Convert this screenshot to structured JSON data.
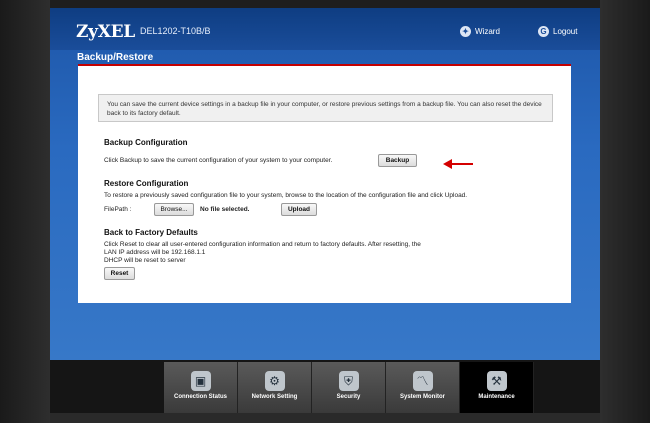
{
  "header": {
    "brand": "ZyXEL",
    "model": "DEL1202-T10B/B",
    "wizard_label": "Wizard",
    "logout_label": "Logout"
  },
  "page_title": "Backup/Restore",
  "info_text": "You can save the current device settings in a backup file in your computer, or restore previous settings from a backup file. You can also reset the device back to its factory default.",
  "backup": {
    "title": "Backup Configuration",
    "desc": "Click Backup to save the current configuration of your system to your computer.",
    "button": "Backup"
  },
  "restore": {
    "title": "Restore Configuration",
    "desc": "To restore a previously saved configuration file to your system, browse to the location of the configuration file and click Upload.",
    "filepath_label": "FilePath :",
    "browse_button": "Browse...",
    "file_status": "No file selected.",
    "upload_button": "Upload"
  },
  "factory": {
    "title": "Back to Factory Defaults",
    "line1": "Click Reset to clear all user-entered configuration information and return to factory defaults. After resetting, the",
    "line2": "LAN IP address will be 192.168.1.1",
    "line3": "DHCP will be reset to server",
    "button": "Reset"
  },
  "nav": {
    "items": [
      {
        "label": "Connection Status",
        "icon": "monitor-icon"
      },
      {
        "label": "Network Setting",
        "icon": "gear-icon"
      },
      {
        "label": "Security",
        "icon": "shield-icon"
      },
      {
        "label": "System Monitor",
        "icon": "graph-icon"
      },
      {
        "label": "Maintenance",
        "icon": "tools-icon"
      }
    ]
  },
  "colors": {
    "accent_red": "#c40000",
    "header_blue": "#0e3d82",
    "app_blue": "#2a6ac0"
  }
}
